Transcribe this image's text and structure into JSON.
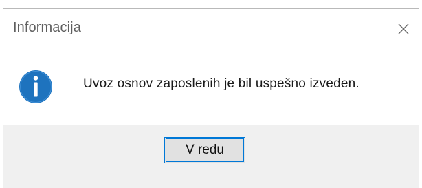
{
  "dialog": {
    "title": "Informacija",
    "close_icon": "close-icon",
    "message_icon": "information-icon",
    "message": "Uvoz osnov zaposlenih je bil uspešno izveden.",
    "ok_button": {
      "mnemonic": "V",
      "rest": " redu"
    }
  },
  "colors": {
    "info_icon_fill": "#1e73be",
    "button_focus_border": "#0078d7",
    "footer_background": "#f0f0f0"
  }
}
